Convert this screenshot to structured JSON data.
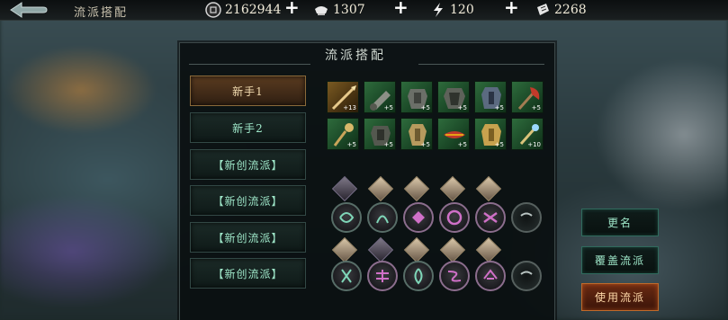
{
  "header": {
    "title": "流派搭配",
    "resources": [
      {
        "name": "coins",
        "icon": "coin-icon",
        "value": "2162944"
      },
      {
        "name": "silver",
        "icon": "silver-ingot-icon",
        "value": "1307"
      },
      {
        "name": "stamina",
        "icon": "lightning-icon",
        "value": "120"
      },
      {
        "name": "tickets",
        "icon": "ticket-icon",
        "value": "2268"
      }
    ],
    "plus_label": "+"
  },
  "panel": {
    "title": "流派搭配",
    "tabs": [
      {
        "label": "新手1",
        "active": true
      },
      {
        "label": "新手2",
        "active": false
      },
      {
        "label": "【新创流派】",
        "active": false
      },
      {
        "label": "【新创流派】",
        "active": false
      },
      {
        "label": "【新创流派】",
        "active": false
      },
      {
        "label": "【新创流派】",
        "active": false
      }
    ],
    "equipment_rows": [
      [
        {
          "icon": "spear-icon",
          "level": "+13",
          "rarity": "gold"
        },
        {
          "icon": "cannon-icon",
          "level": "+5",
          "rarity": "green"
        },
        {
          "icon": "armor-icon",
          "level": "+5",
          "rarity": "green"
        },
        {
          "icon": "armor-icon",
          "level": "+5",
          "rarity": "green"
        },
        {
          "icon": "armor-icon",
          "level": "+5",
          "rarity": "green"
        },
        {
          "icon": "axe-icon",
          "level": "+5",
          "rarity": "green"
        }
      ],
      [
        {
          "icon": "flail-icon",
          "level": "+5",
          "rarity": "green"
        },
        {
          "icon": "armor-icon",
          "level": "+5",
          "rarity": "green"
        },
        {
          "icon": "armor-icon",
          "level": "+5",
          "rarity": "green"
        },
        {
          "icon": "scroll-icon",
          "level": "+5",
          "rarity": "green"
        },
        {
          "icon": "armor-icon",
          "level": "+5",
          "rarity": "green"
        },
        {
          "icon": "staff-icon",
          "level": "+10",
          "rarity": "green"
        }
      ]
    ],
    "character_rows": [
      [
        {
          "skill_icon": "swirl-icon",
          "portrait": "dark",
          "ring": "teal"
        },
        {
          "skill_icon": "swirl-icon",
          "portrait": "light",
          "ring": "teal"
        },
        {
          "skill_icon": "swirl-icon",
          "portrait": "light",
          "ring": "pink"
        },
        {
          "skill_icon": "swirl-icon",
          "portrait": "light",
          "ring": "pink"
        },
        {
          "skill_icon": "swirl-icon",
          "portrait": "light",
          "ring": "pink"
        },
        {
          "skill_icon": "empty-slot-icon",
          "portrait": "none",
          "ring": "empty"
        }
      ],
      [
        {
          "skill_icon": "swirl-icon",
          "portrait": "light",
          "ring": "teal"
        },
        {
          "skill_icon": "swirl-icon",
          "portrait": "dark",
          "ring": "pink"
        },
        {
          "skill_icon": "swirl-icon",
          "portrait": "light",
          "ring": "teal"
        },
        {
          "skill_icon": "swirl-icon",
          "portrait": "light",
          "ring": "pink"
        },
        {
          "skill_icon": "swirl-icon",
          "portrait": "light",
          "ring": "pink"
        },
        {
          "skill_icon": "empty-slot-icon",
          "portrait": "none",
          "ring": "empty"
        }
      ]
    ]
  },
  "actions": {
    "rename": "更名",
    "overwrite": "覆盖流派",
    "use": "使用流派"
  },
  "colors": {
    "accent_teal": "#9ee6c8",
    "active_tab": "#5a3b20",
    "use_button": "#6a2a12"
  }
}
